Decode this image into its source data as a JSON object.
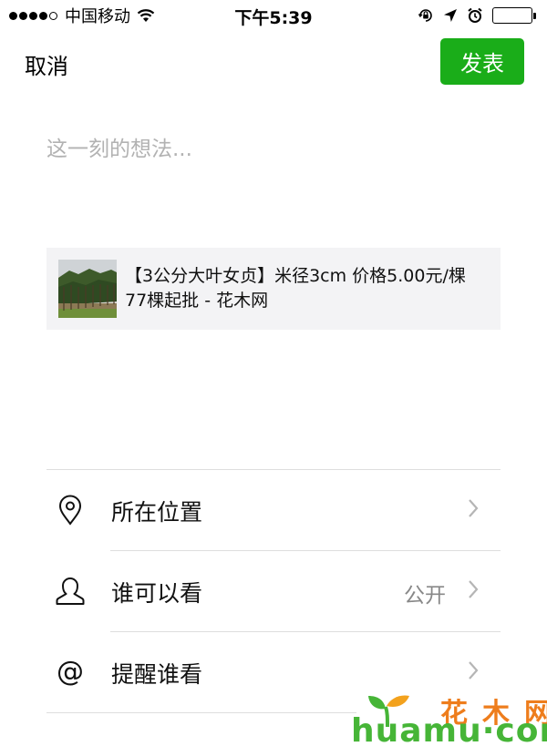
{
  "status_bar": {
    "carrier": "中国移动",
    "time": "下午5:39",
    "signal_strength": 4,
    "signal_max": 5,
    "battery_level": 1.0,
    "icons": [
      "wifi-icon",
      "orientation-lock-icon",
      "location-arrow-icon",
      "alarm-icon",
      "battery-icon"
    ]
  },
  "nav": {
    "cancel_label": "取消",
    "publish_label": "发表",
    "publish_color": "#1aad19"
  },
  "compose": {
    "placeholder": "这一刻的想法...",
    "value": ""
  },
  "link_card": {
    "title": "【3公分大叶女贞】米径3cm 价格5.00元/棵 77棵起批 - 花木网",
    "thumbnail_icon": "tree-nursery-thumbnail"
  },
  "options": [
    {
      "label": "所在位置",
      "value": "",
      "icon": "location-pin-icon"
    },
    {
      "label": "谁可以看",
      "value": "公开",
      "icon": "person-icon"
    },
    {
      "label": "提醒谁看",
      "value": "",
      "icon": "at-icon"
    }
  ],
  "watermark": {
    "chinese": "花木网",
    "english": "huamu·com"
  },
  "colors": {
    "accent_green": "#1aad19",
    "placeholder_gray": "#b2b2b2",
    "card_background": "#f3f3f5",
    "watermark_orange": "#ee7d1c",
    "watermark_green": "#46b537"
  }
}
